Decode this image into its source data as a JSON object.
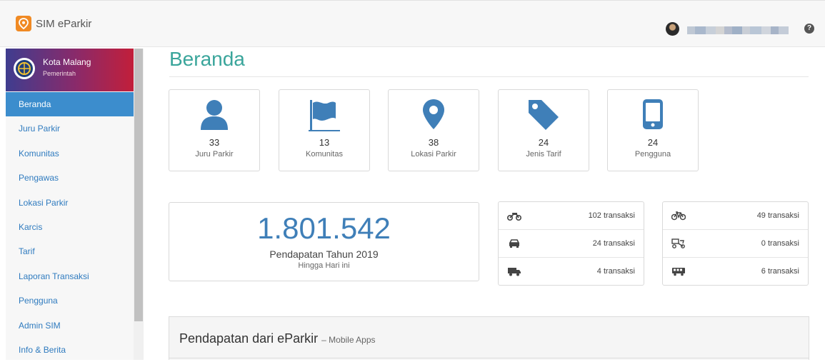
{
  "app": {
    "title": "SIM eParkir"
  },
  "user": {
    "help": "?"
  },
  "sidebar": {
    "profile": {
      "name": "Kota Malang",
      "role": "Pemerintah"
    },
    "items": [
      {
        "label": "Beranda",
        "active": true
      },
      {
        "label": "Juru Parkir"
      },
      {
        "label": "Komunitas"
      },
      {
        "label": "Pengawas"
      },
      {
        "label": "Lokasi Parkir"
      },
      {
        "label": "Karcis"
      },
      {
        "label": "Tarif"
      },
      {
        "label": "Laporan Transaksi"
      },
      {
        "label": "Pengguna"
      },
      {
        "label": "Admin SIM"
      },
      {
        "label": "Info & Berita"
      }
    ]
  },
  "page": {
    "title": "Beranda"
  },
  "stats": [
    {
      "value": "33",
      "label": "Juru Parkir",
      "icon": "user-icon"
    },
    {
      "value": "13",
      "label": "Komunitas",
      "icon": "flag-icon"
    },
    {
      "value": "38",
      "label": "Lokasi Parkir",
      "icon": "map-marker-icon"
    },
    {
      "value": "24",
      "label": "Jenis Tarif",
      "icon": "tag-icon"
    },
    {
      "value": "24",
      "label": "Pengguna",
      "icon": "mobile-phone-icon"
    }
  ],
  "revenue": {
    "value": "1.801.542",
    "label": "Pendapatan Tahun 2019",
    "sub": "Hingga Hari ini"
  },
  "transactions": {
    "left": [
      {
        "icon": "motorcycle-icon",
        "text": "102 transaksi"
      },
      {
        "icon": "car-icon",
        "text": "24 transaksi"
      },
      {
        "icon": "truck-icon",
        "text": "4 transaksi"
      }
    ],
    "right": [
      {
        "icon": "bicycle-icon",
        "text": "49 transaksi"
      },
      {
        "icon": "tricycle-icon",
        "text": "0 transaksi"
      },
      {
        "icon": "bus-icon",
        "text": "6 transaksi"
      }
    ]
  },
  "panel": {
    "title": "Pendapatan dari eParkir",
    "subtitle": "– Mobile Apps"
  },
  "colors": {
    "accent": "#3c8dcd",
    "title": "#3aa59b",
    "icon": "#3f7fb8",
    "brand": "#f08a24"
  }
}
